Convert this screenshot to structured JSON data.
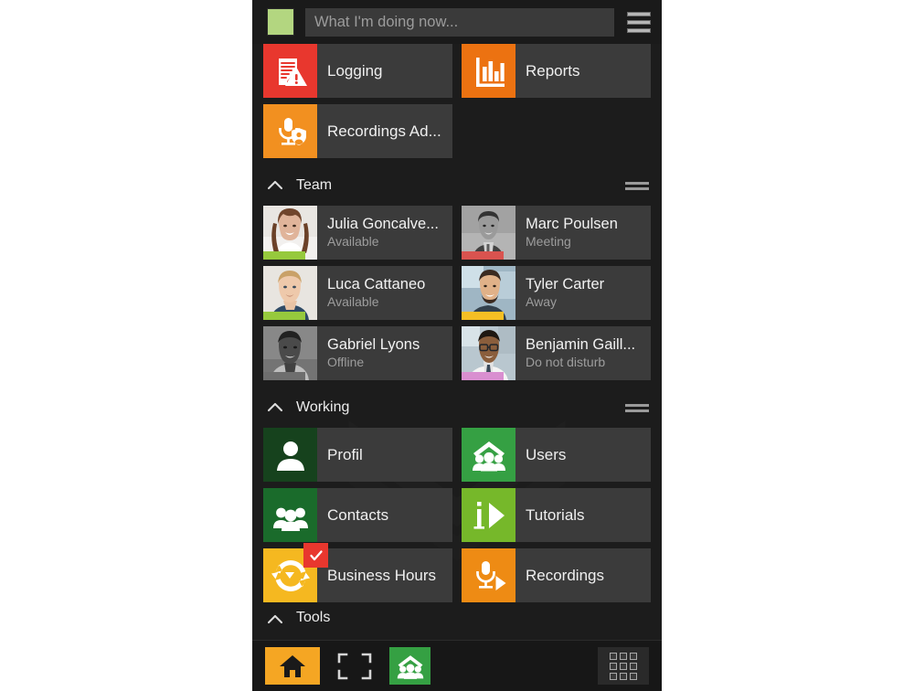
{
  "app": {
    "background_color": "#1c1c1c",
    "tile_bg": "#3b3b3b"
  },
  "topbar": {
    "presence_color": "#b3d680",
    "presence_name": "available-status-indicator",
    "status_placeholder": "What I'm doing now...",
    "status_value": "",
    "menu_icon": "hamburger-menu-icon"
  },
  "quick_tiles": [
    {
      "label": "Logging",
      "icon": "log-warning-icon",
      "color": "#e8372e"
    },
    {
      "label": "Reports",
      "icon": "bar-chart-icon",
      "color": "#ec7211"
    },
    {
      "label": "Recordings Ad...",
      "icon": "microphone-shield-icon",
      "color": "#f29020"
    }
  ],
  "sections": [
    {
      "title": "Team",
      "collapse_icon": "chevron-up-icon",
      "drag_icon": "drag-handle-icon",
      "contacts": [
        {
          "name": "Julia Goncalve...",
          "status": "Available",
          "presence_color": "#96c93d",
          "avatar": "woman-smiling-brown-hair",
          "gray": false
        },
        {
          "name": "Marc Poulsen",
          "status": "Meeting",
          "presence_color": "#d9534f",
          "avatar": "man-suit-short-hair",
          "gray": true
        },
        {
          "name": "Luca Cattaneo",
          "status": "Available",
          "presence_color": "#96c93d",
          "avatar": "man-blond-blue-shirt",
          "gray": false
        },
        {
          "name": "Tyler Carter",
          "status": "Away",
          "presence_color": "#f5bf24",
          "avatar": "man-beard-office",
          "gray": false
        },
        {
          "name": "Gabriel Lyons",
          "status": "Offline",
          "presence_color": "#6e6e6e",
          "avatar": "man-dark-skin-shirt",
          "gray": true
        },
        {
          "name": "Benjamin Gaill...",
          "status": "Do not disturb",
          "presence_color": "#d98fd0",
          "avatar": "man-glasses-white-shirt",
          "gray": false
        }
      ]
    },
    {
      "title": "Working",
      "collapse_icon": "chevron-up-icon",
      "drag_icon": "drag-handle-icon",
      "tiles": [
        {
          "label": "Profil",
          "icon": "person-icon",
          "color": "#16421d",
          "badge": null
        },
        {
          "label": "Users",
          "icon": "users-house-icon",
          "color": "#35a043",
          "badge": null
        },
        {
          "label": "Contacts",
          "icon": "contacts-group-icon",
          "color": "#1a6b2b",
          "badge": null
        },
        {
          "label": "Tutorials",
          "icon": "info-play-icon",
          "color": "#76b82a",
          "badge": null
        },
        {
          "label": "Business Hours",
          "icon": "cycle-arrows-icon",
          "color": "#f5b820",
          "badge": "checkmark-badge"
        },
        {
          "label": "Recordings",
          "icon": "microphone-play-icon",
          "color": "#ee8b14",
          "badge": null
        }
      ]
    }
  ],
  "cut_section": {
    "title": "Tools"
  },
  "bottombar": {
    "buttons": [
      {
        "name": "home-button",
        "icon": "home-icon",
        "color": "#f5a623"
      },
      {
        "name": "fullscreen-button",
        "icon": "fullscreen-icon",
        "color": "transparent"
      },
      {
        "name": "users-button",
        "icon": "users-house-icon",
        "color": "#35a043"
      }
    ],
    "keypad": {
      "name": "keypad-button",
      "icon": "dialpad-grid-icon"
    }
  }
}
